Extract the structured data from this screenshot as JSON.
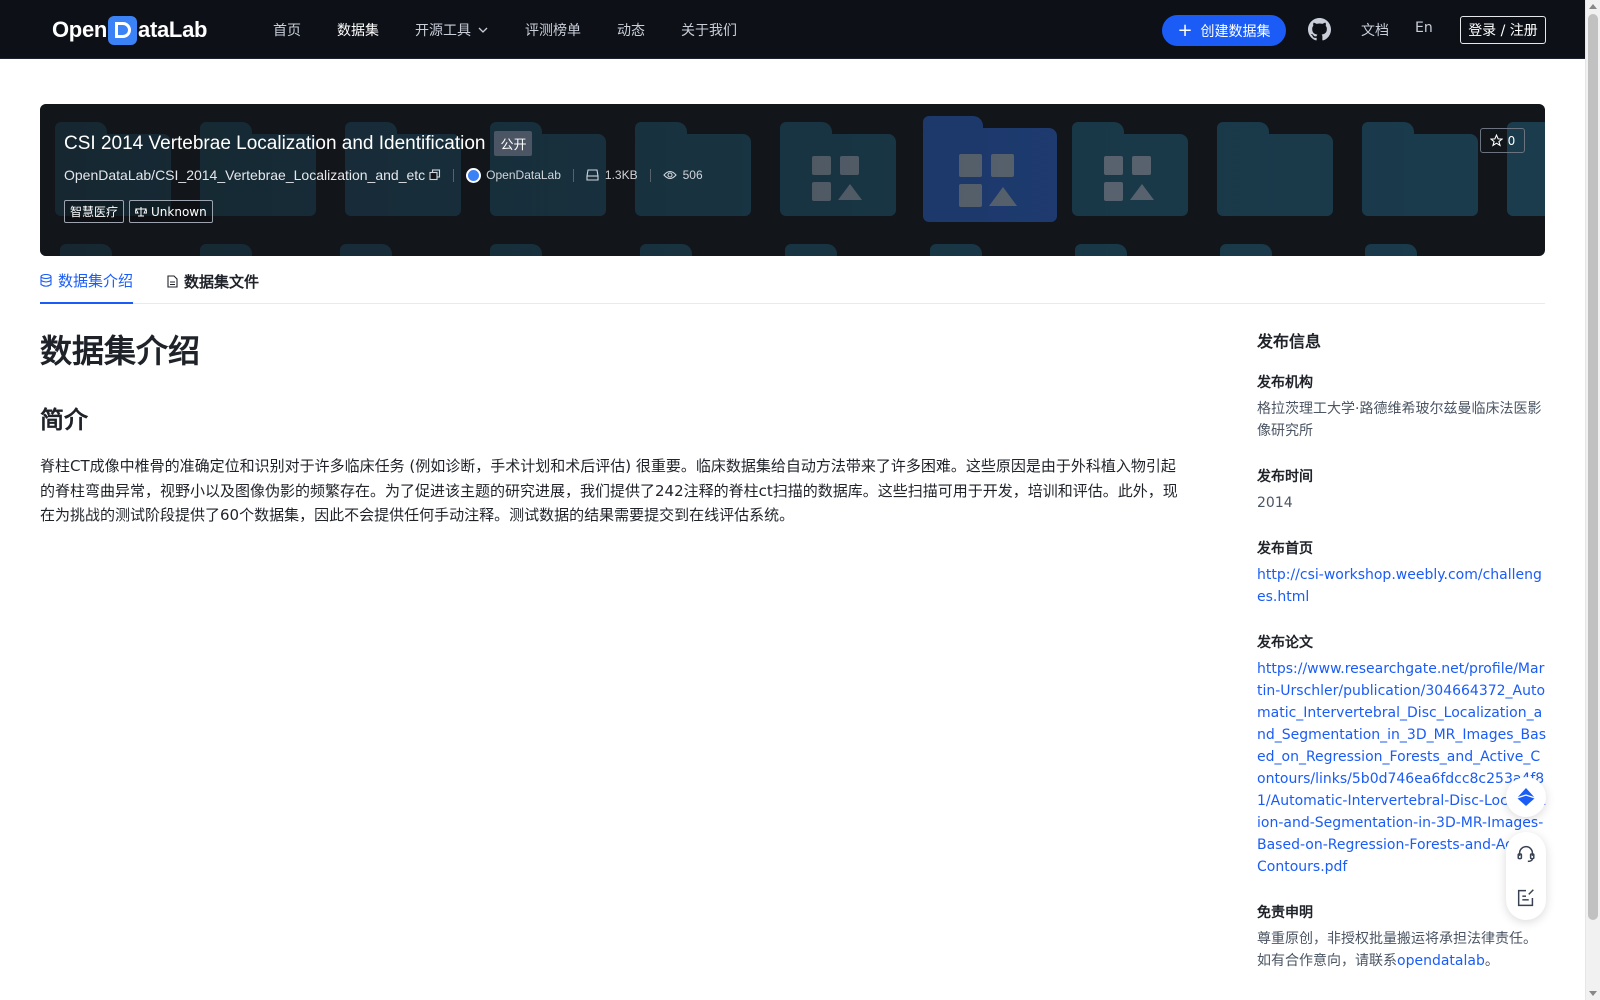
{
  "nav": {
    "logo_text_left": "Open",
    "logo_text_right": "ataLab",
    "links": [
      {
        "label": "首页"
      },
      {
        "label": "数据集"
      },
      {
        "label": "开源工具"
      },
      {
        "label": "评测榜单"
      },
      {
        "label": "动态"
      },
      {
        "label": "关于我们"
      }
    ],
    "create_button": "创建数据集",
    "docs": "文档",
    "lang": "En",
    "login": "登录 / 注册"
  },
  "dataset": {
    "title": "CSI 2014 Vertebrae Localization and Identification",
    "visibility": "公开",
    "path": "OpenDataLab/CSI_2014_Vertebrae_Localization_and_etc",
    "org": "OpenDataLab",
    "size": "1.3KB",
    "views": "506",
    "tags": [
      "智慧医疗",
      "Unknown"
    ],
    "stars": "0"
  },
  "tabs": [
    {
      "label": "数据集介绍"
    },
    {
      "label": "数据集文件"
    }
  ],
  "content": {
    "heading": "数据集介绍",
    "subheading": "简介",
    "intro": "脊柱CT成像中椎骨的准确定位和识别对于许多临床任务 (例如诊断，手术计划和术后评估) 很重要。临床数据集给自动方法带来了许多困难。这些原因是由于外科植入物引起的脊柱弯曲异常，视野小以及图像伪影的频繁存在。为了促进该主题的研究进展，我们提供了242注释的脊柱ct扫描的数据库。这些扫描可用于开发，培训和评估。此外，现在为挑战的测试阶段提供了60个数据集，因此不会提供任何手动注释。测试数据的结果需要提交到在线评估系统。"
  },
  "side": {
    "title": "发布信息",
    "org_label": "发布机构",
    "org_value": "格拉茨理工大学·路德维希玻尔兹曼临床法医影像研究所",
    "time_label": "发布时间",
    "time_value": "2014",
    "home_label": "发布首页",
    "home_value": "http://csi-workshop.weebly.com/challenges.html",
    "paper_label": "发布论文",
    "paper_value": "https://www.researchgate.net/profile/Martin-Urschler/publication/304664372_Automatic_Intervertebral_Disc_Localization_and_Segmentation_in_3D_MR_Images_Based_on_Regression_Forests_and_Active_Contours/links/5b0d746ea6fdcc8c253a4f81/Automatic-Intervertebral-Disc-Localization-and-Segmentation-in-3D-MR-Images-Based-on-Regression-Forests-and-Active-Contours.pdf",
    "disclaimer_label": "免责申明",
    "disclaimer_text": "尊重原创，非授权批量搬运将承担法律责任。如有合作意向，请联系",
    "disclaimer_link": "opendatalab",
    "disclaimer_end": "。"
  },
  "colors": {
    "accent": "#1a5cf5",
    "nav_bg": "#0d1117",
    "banner_bg": "#121519"
  },
  "icons": {
    "github": "github-icon",
    "plus": "plus-icon",
    "chevron": "chevron-down-icon",
    "copy": "copy-icon",
    "disk": "disk-icon",
    "eye": "eye-icon",
    "scale": "scale-icon",
    "star": "star-icon",
    "database": "database-icon",
    "file": "file-icon",
    "rocket": "scroll-top-icon",
    "headset": "support-icon",
    "feedback": "feedback-icon"
  }
}
